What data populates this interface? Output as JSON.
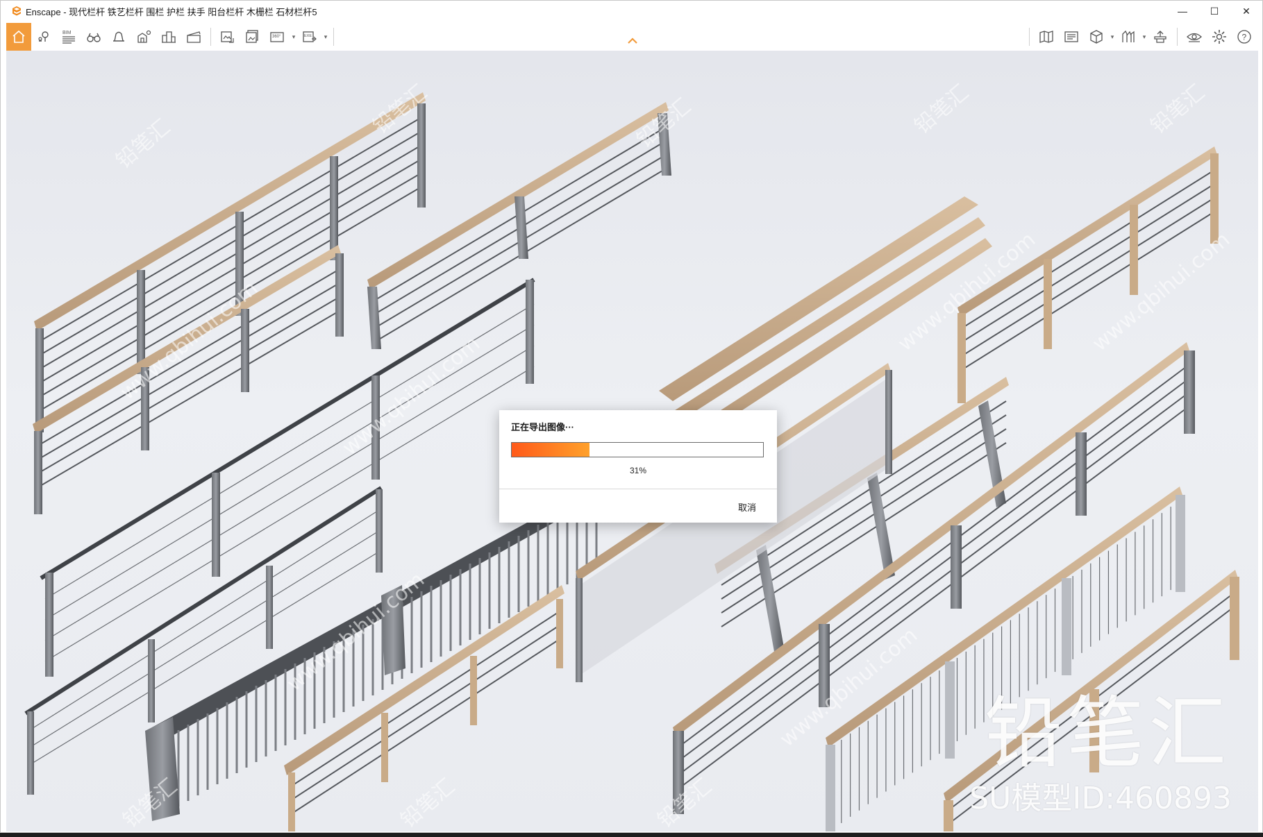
{
  "window": {
    "title": "Enscape - 现代栏杆 铁艺栏杆 围栏 护栏 扶手 阳台栏杆 木栅栏 石材栏杆5",
    "accent_color": "#f29b3b",
    "controls": [
      {
        "name": "minimize-icon",
        "glyph": "—"
      },
      {
        "name": "maximize-icon",
        "glyph": "☐"
      },
      {
        "name": "close-icon",
        "glyph": "✕"
      }
    ]
  },
  "toolbar": {
    "left_icons": [
      "home-icon",
      "location-pin-icon",
      "bim-icon",
      "binoculars-icon",
      "bell-view-icon",
      "sun-house-icon",
      "buildings-icon",
      "clapperboard-icon"
    ],
    "export_icons": [
      "screenshot-export-icon",
      "batch-export-icon",
      "panorama-360-icon",
      "exe-export-icon"
    ],
    "right_icons": [
      "map-icon",
      "video-editor-icon",
      "cube-icon",
      "asset-library-icon",
      "upload-icon",
      "visibility-icon",
      "settings-gear-icon",
      "help-icon"
    ],
    "bim_label": "BIM",
    "pano_label": "360°",
    "exe_label": "EXE",
    "help_label": "?"
  },
  "dialog": {
    "title": "正在导出图像···",
    "progress_percent": 31,
    "progress_label": "31%",
    "cancel_label": "取消",
    "progress_color_start": "#ff5a1a",
    "progress_color_end": "#ffa12b"
  },
  "watermark": {
    "brand": "铅笔汇",
    "model_id": "SU模型ID:460893",
    "diag_text": "www.qbihui.com",
    "diag_short": "铅笔汇"
  }
}
